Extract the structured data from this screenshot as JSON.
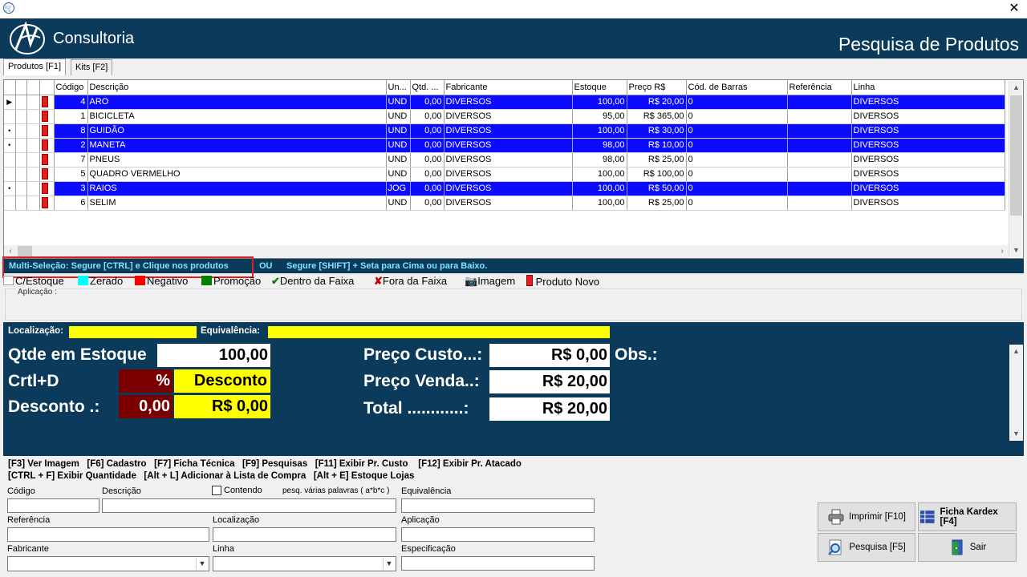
{
  "app": {
    "title_brand": "Consultoria",
    "screen_title": "Pesquisa de Produtos",
    "close_glyph": "✕"
  },
  "tabs": [
    {
      "label": "Produtos [F1]"
    },
    {
      "label": "Kits [F2]"
    }
  ],
  "grid": {
    "columns": [
      "Código",
      "Descrição",
      "Un...",
      "Qtd. ...",
      "Fabricante",
      "Estoque",
      "Preço R$",
      "Cód. de Barras",
      "Referência",
      "Linha"
    ],
    "rows": [
      {
        "indicator": "▶",
        "codigo": "4",
        "descricao": "ARO",
        "un": "UND",
        "qtd": "0,00",
        "fabricante": "DIVERSOS",
        "estoque": "100,00",
        "preco": "R$ 20,00",
        "barras": "0",
        "referencia": "",
        "linha": "DIVERSOS",
        "selected": true
      },
      {
        "indicator": "",
        "codigo": "1",
        "descricao": "BICICLETA",
        "un": "UND",
        "qtd": "0,00",
        "fabricante": "DIVERSOS",
        "estoque": "95,00",
        "preco": "R$ 365,00",
        "barras": "0",
        "referencia": "",
        "linha": "DIVERSOS",
        "selected": false
      },
      {
        "indicator": "•",
        "codigo": "8",
        "descricao": "GUIDÃO",
        "un": "UND",
        "qtd": "0,00",
        "fabricante": "DIVERSOS",
        "estoque": "100,00",
        "preco": "R$ 30,00",
        "barras": "0",
        "referencia": "",
        "linha": "DIVERSOS",
        "selected": true
      },
      {
        "indicator": "•",
        "codigo": "2",
        "descricao": "MANETA",
        "un": "UND",
        "qtd": "0,00",
        "fabricante": "DIVERSOS",
        "estoque": "98,00",
        "preco": "R$ 10,00",
        "barras": "0",
        "referencia": "",
        "linha": "DIVERSOS",
        "selected": true
      },
      {
        "indicator": "",
        "codigo": "7",
        "descricao": "PNEUS",
        "un": "UND",
        "qtd": "0,00",
        "fabricante": "DIVERSOS",
        "estoque": "98,00",
        "preco": "R$ 25,00",
        "barras": "0",
        "referencia": "",
        "linha": "DIVERSOS",
        "selected": false
      },
      {
        "indicator": "",
        "codigo": "5",
        "descricao": "QUADRO VERMELHO",
        "un": "UND",
        "qtd": "0,00",
        "fabricante": "DIVERSOS",
        "estoque": "100,00",
        "preco": "R$ 100,00",
        "barras": "0",
        "referencia": "",
        "linha": "DIVERSOS",
        "selected": false
      },
      {
        "indicator": "•",
        "codigo": "3",
        "descricao": "RAIOS",
        "un": "JOG",
        "qtd": "0,00",
        "fabricante": "DIVERSOS",
        "estoque": "100,00",
        "preco": "R$ 50,00",
        "barras": "0",
        "referencia": "",
        "linha": "DIVERSOS",
        "selected": true
      },
      {
        "indicator": "",
        "codigo": "6",
        "descricao": "SELIM",
        "un": "UND",
        "qtd": "0,00",
        "fabricante": "DIVERSOS",
        "estoque": "100,00",
        "preco": "R$ 25,00",
        "barras": "0",
        "referencia": "",
        "linha": "DIVERSOS",
        "selected": false
      }
    ]
  },
  "multi_selection": {
    "part1": "Multi-Seleção: Segure [CTRL] e Clique nos produtos",
    "or": "OU",
    "part2": "Segure [SHIFT] + Seta para Cima ou para Baixo."
  },
  "legend": [
    {
      "label": "C/Estoque",
      "color": "#ffffff"
    },
    {
      "label": "Zerado",
      "color": "#00ffff"
    },
    {
      "label": "Negativo",
      "color": "#ff0000"
    },
    {
      "label": "Promoção",
      "color": "#008000"
    },
    {
      "label": "Dentro da Faixa",
      "icon": "check-icon"
    },
    {
      "label": "Fora da Faixa",
      "icon": "x-icon"
    },
    {
      "label": "Imagem",
      "icon": "camera-icon"
    },
    {
      "label": "Produto Novo",
      "icon": "tag-icon"
    }
  ],
  "aplicacao_label": "Aplicação :",
  "info": {
    "localizacao_label": "Localização:",
    "equivalencia_label": "Equivalência:",
    "qtde_label": "Qtde em Estoque",
    "qtde_value": "100,00",
    "crtl_label": "Crtl+D",
    "percent_symbol": "%",
    "desconto_word": "Desconto",
    "desconto_label": "Desconto .:",
    "desconto_value": "0,00",
    "desconto_money": "R$ 0,00",
    "custo_label": "Preço Custo...:",
    "custo_value": "R$ 0,00",
    "venda_label": "Preço Venda..:",
    "venda_value": "R$ 20,00",
    "total_label": "Total ............:",
    "total_value": "R$ 20,00",
    "obs_label": "Obs.:"
  },
  "shortcuts": {
    "line1": "[F3] Ver Imagem   [F6] Cadastro   [F7] Ficha Técnica   [F9] Pesquisas   [F11] Exibir Pr. Custo    [F12] Exibir Pr. Atacado",
    "line2": "[CTRL + F] Exibir Quantidade   [Alt + L] Adicionar à Lista de Compra   [Alt + E] Estoque Lojas"
  },
  "filters": {
    "codigo": "Código",
    "descricao": "Descrição",
    "contendo": "Contendo",
    "pesq_hint": "pesq. várias palavras ( a*b*c )",
    "equivalencia": "Equivalência",
    "referencia": "Referência",
    "localizacao": "Localização",
    "aplicacao": "Aplicação",
    "fabricante": "Fabricante",
    "linha": "Linha",
    "especificacao": "Especificação"
  },
  "buttons": {
    "imprimir": "Imprimir [F10]",
    "kardex": "Ficha Kardex [F4]",
    "pesquisa": "Pesquisa [F5]",
    "sair": "Sair"
  }
}
